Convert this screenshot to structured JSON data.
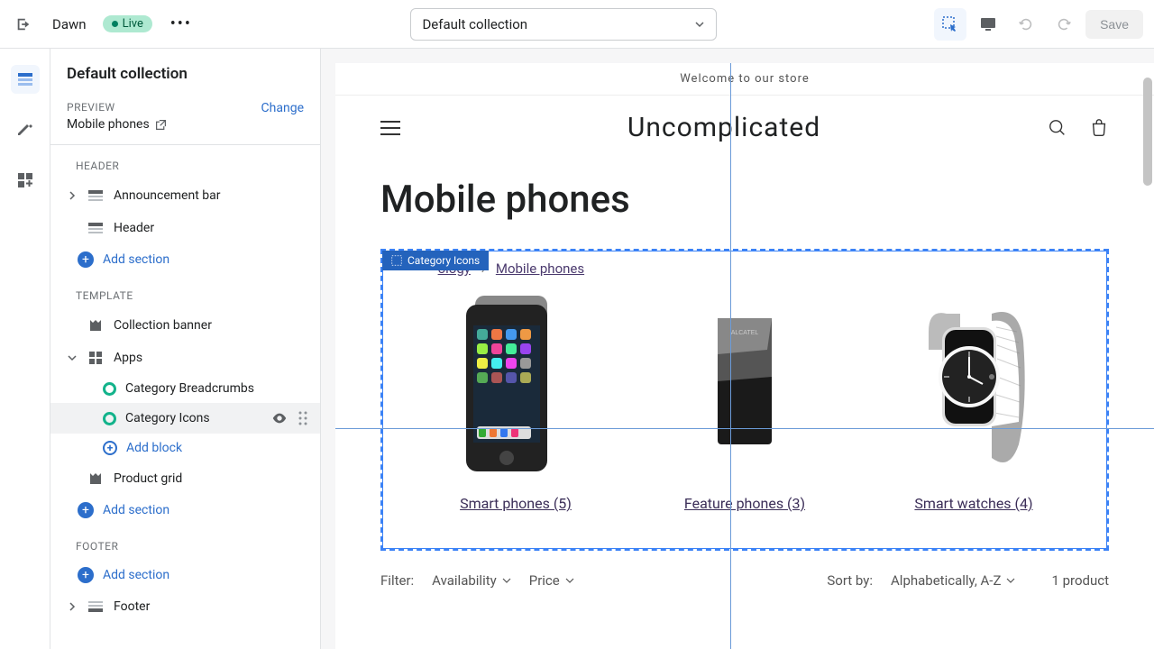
{
  "topbar": {
    "theme_name": "Dawn",
    "live_badge": "Live",
    "template_selector": "Default collection",
    "save_label": "Save"
  },
  "sidebar": {
    "title": "Default collection",
    "preview_label": "PREVIEW",
    "preview_value": "Mobile phones",
    "change_label": "Change",
    "groups": {
      "header": "HEADER",
      "template": "TEMPLATE",
      "footer": "FOOTER"
    },
    "items": {
      "announcement_bar": "Announcement bar",
      "header": "Header",
      "collection_banner": "Collection banner",
      "apps": "Apps",
      "category_breadcrumbs": "Category Breadcrumbs",
      "category_icons": "Category Icons",
      "product_grid": "Product grid",
      "footer": "Footer"
    },
    "add_section": "Add section",
    "add_block": "Add block"
  },
  "preview": {
    "announcement": "Welcome to our store",
    "store_name": "Uncomplicated",
    "collection_title": "Mobile phones",
    "block_tag": "Category Icons",
    "breadcrumb": {
      "part1_suffix": "ology",
      "part2": "Mobile phones"
    },
    "categories": [
      {
        "label": "Smart phones (5)"
      },
      {
        "label": "Feature phones (3)"
      },
      {
        "label": "Smart watches (4)"
      }
    ],
    "filter_label": "Filter:",
    "filter_availability": "Availability",
    "filter_price": "Price",
    "sort_label": "Sort by:",
    "sort_value": "Alphabetically, A-Z",
    "product_count": "1 product"
  }
}
